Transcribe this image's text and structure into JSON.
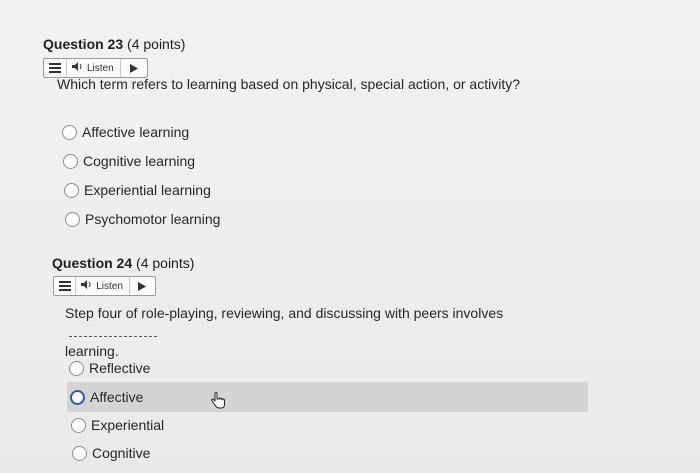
{
  "questions": [
    {
      "title_number": "Question 23",
      "title_points": "(4 points)",
      "listen_label": "Listen",
      "prompt": "Which term refers to learning based on physical, special action, or activity?",
      "options": [
        "Affective learning",
        "Cognitive learning",
        "Experiential learning",
        "Psychomotor learning"
      ]
    },
    {
      "title_number": "Question 24",
      "title_points": "(4 points)",
      "listen_label": "Listen",
      "prompt_line1": "Step four of role-playing, reviewing, and discussing with peers involves",
      "prompt_line2": "learning.",
      "options": [
        "Reflective",
        "Affective",
        "Experiential",
        "Cognitive"
      ],
      "hovered_option": "Affective"
    }
  ],
  "icons": [
    "menu-icon",
    "speaker-icon",
    "play-icon",
    "hand-pointer-icon"
  ],
  "colors": {
    "background": "#eeeeee",
    "hover_row": "#d4d4d4",
    "radio_focus": "#2d5da0"
  }
}
